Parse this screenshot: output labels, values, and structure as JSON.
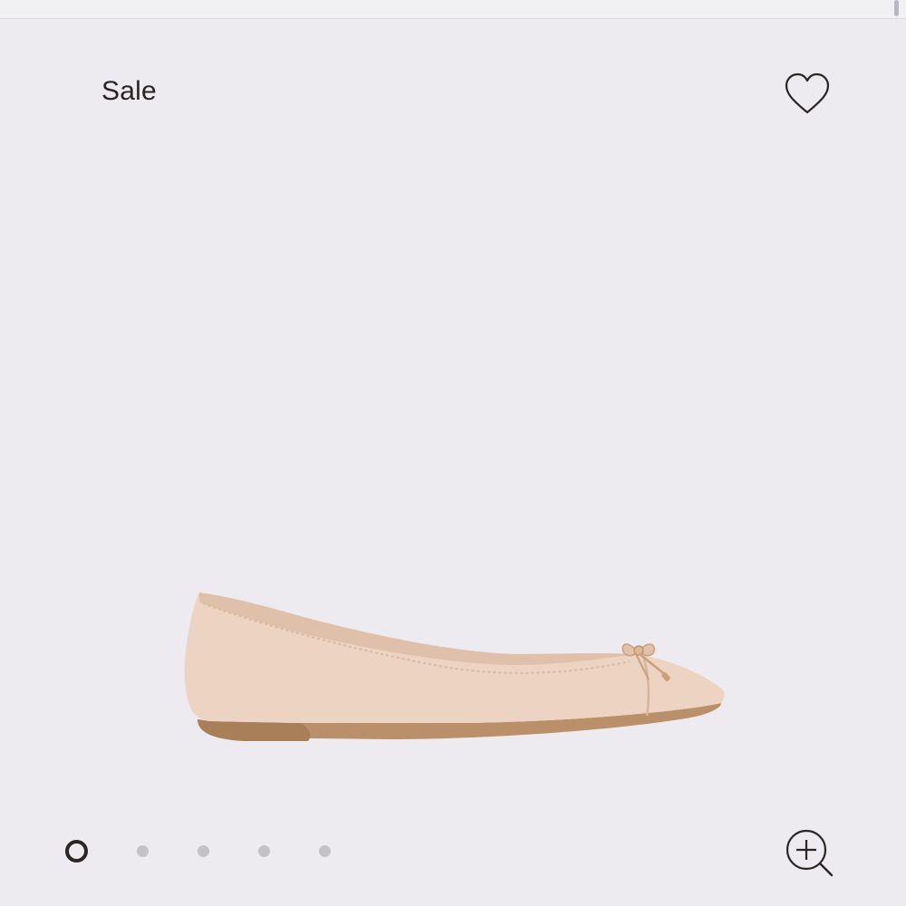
{
  "badge": {
    "label": "Sale"
  },
  "product": {
    "image_icon": "ballet-flat-shoe-image",
    "shoe_color": "#ecd3c2",
    "sole_color": "#b99069"
  },
  "gallery": {
    "slide_count": 5,
    "active_index": 0
  },
  "actions": {
    "wishlist_icon": "heart-icon",
    "zoom_icon": "zoom-in-icon"
  },
  "colors": {
    "background": "#edebef",
    "text": "#2a2523",
    "dot_inactive": "#c4c2c7"
  }
}
